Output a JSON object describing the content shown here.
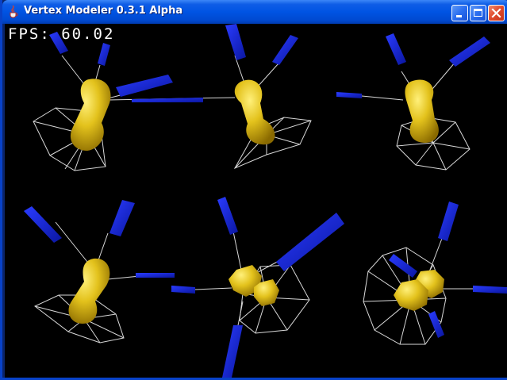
{
  "window": {
    "title": "Vertex Modeler 0.3.1 Alpha",
    "icon": "java-cup-icon",
    "buttons": {
      "minimize": "minimize-icon",
      "maximize": "maximize-icon",
      "close": "close-icon"
    }
  },
  "viewport": {
    "fps_label": "FPS:",
    "fps_value": "60.02",
    "background": "#000000",
    "model_color": "#e0c020",
    "bone_color": "#1a2ee0",
    "wire_color": "#d8d8d8"
  }
}
